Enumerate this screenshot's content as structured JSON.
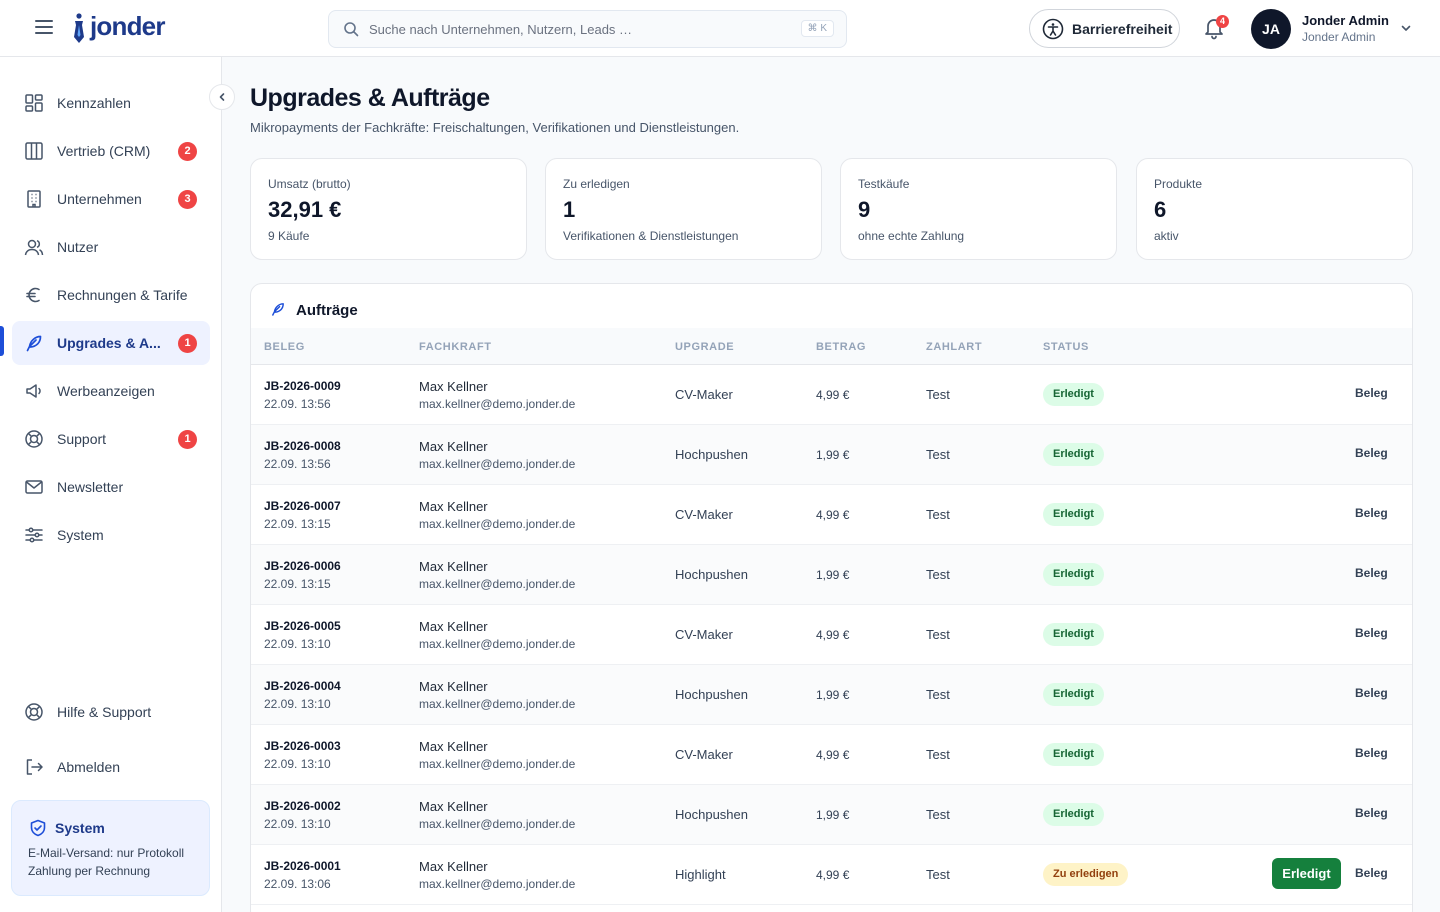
{
  "header": {
    "logo_text": "jonder",
    "search_placeholder": "Suche nach Unternehmen, Nutzern, Leads …",
    "search_shortcut": "⌘ K",
    "accessibility_label": "Barrierefreiheit",
    "notification_count": "4",
    "user": {
      "initials": "JA",
      "name": "Jonder Admin",
      "role": "Jonder Admin"
    }
  },
  "sidebar": {
    "items": [
      {
        "label": "Kennzahlen",
        "icon": "grid-icon",
        "badge": ""
      },
      {
        "label": "Vertrieb (CRM)",
        "icon": "columns-icon",
        "badge": "2"
      },
      {
        "label": "Unternehmen",
        "icon": "building-icon",
        "badge": "3"
      },
      {
        "label": "Nutzer",
        "icon": "users-icon",
        "badge": ""
      },
      {
        "label": "Rechnungen & Tarife",
        "icon": "euro-icon",
        "badge": ""
      },
      {
        "label": "Upgrades & A...",
        "icon": "feather-icon",
        "badge": "1",
        "active": true
      },
      {
        "label": "Werbeanzeigen",
        "icon": "megaphone-icon",
        "badge": ""
      },
      {
        "label": "Support",
        "icon": "lifebuoy-icon",
        "badge": "1"
      },
      {
        "label": "Newsletter",
        "icon": "mail-icon",
        "badge": ""
      },
      {
        "label": "System",
        "icon": "sliders-icon",
        "badge": ""
      }
    ],
    "help_label": "Hilfe & Support",
    "logout_label": "Abmelden",
    "system_card": {
      "title": "System",
      "line1": "E-Mail-Versand: nur Protokoll",
      "line2": "Zahlung per Rechnung"
    }
  },
  "page": {
    "title": "Upgrades & Aufträge",
    "subtitle": "Mikropayments der Fachkräfte: Freischaltungen, Verifikationen und Dienstleistungen."
  },
  "kpis": [
    {
      "label": "Umsatz (brutto)",
      "value": "32,91 €",
      "sub": "9 Käufe"
    },
    {
      "label": "Zu erledigen",
      "value": "1",
      "sub": "Verifikationen & Dienstleistungen"
    },
    {
      "label": "Testkäufe",
      "value": "9",
      "sub": "ohne echte Zahlung"
    },
    {
      "label": "Produkte",
      "value": "6",
      "sub": "aktiv"
    }
  ],
  "orders": {
    "title": "Aufträge",
    "columns": [
      "BELEG",
      "FACHKRAFT",
      "UPGRADE",
      "BETRAG",
      "ZAHLART",
      "STATUS"
    ],
    "receipt_label": "Beleg",
    "done_button_label": "Erledigt",
    "rows": [
      {
        "id": "JB-2026-0009",
        "date": "22.09. 13:56",
        "name": "Max Kellner",
        "email": "max.kellner@demo.jonder.de",
        "upgrade": "CV-Maker",
        "amount": "4,99 €",
        "payment": "Test",
        "status": "Erledigt",
        "status_type": "done"
      },
      {
        "id": "JB-2026-0008",
        "date": "22.09. 13:56",
        "name": "Max Kellner",
        "email": "max.kellner@demo.jonder.de",
        "upgrade": "Hochpushen",
        "amount": "1,99 €",
        "payment": "Test",
        "status": "Erledigt",
        "status_type": "done"
      },
      {
        "id": "JB-2026-0007",
        "date": "22.09. 13:15",
        "name": "Max Kellner",
        "email": "max.kellner@demo.jonder.de",
        "upgrade": "CV-Maker",
        "amount": "4,99 €",
        "payment": "Test",
        "status": "Erledigt",
        "status_type": "done"
      },
      {
        "id": "JB-2026-0006",
        "date": "22.09. 13:15",
        "name": "Max Kellner",
        "email": "max.kellner@demo.jonder.de",
        "upgrade": "Hochpushen",
        "amount": "1,99 €",
        "payment": "Test",
        "status": "Erledigt",
        "status_type": "done"
      },
      {
        "id": "JB-2026-0005",
        "date": "22.09. 13:10",
        "name": "Max Kellner",
        "email": "max.kellner@demo.jonder.de",
        "upgrade": "CV-Maker",
        "amount": "4,99 €",
        "payment": "Test",
        "status": "Erledigt",
        "status_type": "done"
      },
      {
        "id": "JB-2026-0004",
        "date": "22.09. 13:10",
        "name": "Max Kellner",
        "email": "max.kellner@demo.jonder.de",
        "upgrade": "Hochpushen",
        "amount": "1,99 €",
        "payment": "Test",
        "status": "Erledigt",
        "status_type": "done"
      },
      {
        "id": "JB-2026-0003",
        "date": "22.09. 13:10",
        "name": "Max Kellner",
        "email": "max.kellner@demo.jonder.de",
        "upgrade": "CV-Maker",
        "amount": "4,99 €",
        "payment": "Test",
        "status": "Erledigt",
        "status_type": "done"
      },
      {
        "id": "JB-2026-0002",
        "date": "22.09. 13:10",
        "name": "Max Kellner",
        "email": "max.kellner@demo.jonder.de",
        "upgrade": "Hochpushen",
        "amount": "1,99 €",
        "payment": "Test",
        "status": "Erledigt",
        "status_type": "done"
      },
      {
        "id": "JB-2026-0001",
        "date": "22.09. 13:06",
        "name": "Max Kellner",
        "email": "max.kellner@demo.jonder.de",
        "upgrade": "Highlight",
        "amount": "4,99 €",
        "payment": "Test",
        "status": "Zu erledigen",
        "status_type": "todo"
      }
    ]
  },
  "colors": {
    "brand": "#1e3a8a",
    "accent": "#1d4ed8",
    "badge": "#ef4444",
    "done_bg": "#dcfce7",
    "done_fg": "#166534",
    "todo_bg": "#fef3c7",
    "todo_fg": "#92400e",
    "done_button": "#15803d"
  }
}
